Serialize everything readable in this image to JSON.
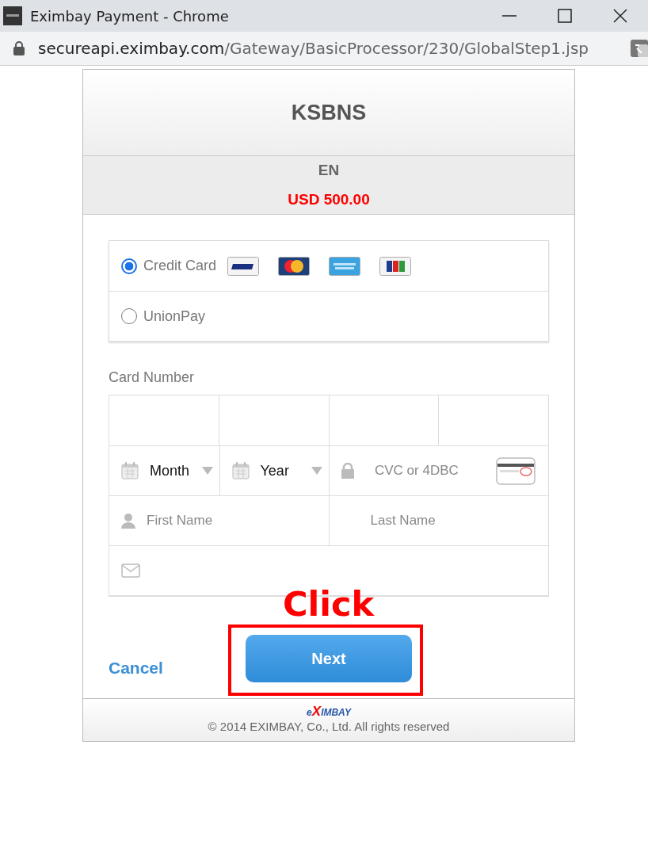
{
  "window": {
    "title": "Eximbay Payment - Chrome",
    "url_host": "secureapi.eximbay.com",
    "url_path": "/Gateway/BasicProcessor/230/GlobalStep1.jsp"
  },
  "merchant": {
    "name": "KSBNS",
    "language": "EN",
    "amount": "USD 500.00"
  },
  "payment_methods": [
    {
      "label": "Credit Card",
      "selected": true,
      "kind": "cards"
    },
    {
      "label": "UnionPay",
      "selected": false,
      "kind": "plain"
    }
  ],
  "card_number": {
    "label": "Card Number"
  },
  "expiry": [
    {
      "value": "Month"
    },
    {
      "value": "Year"
    }
  ],
  "cvc": {
    "placeholder": "CVC or 4DBC"
  },
  "name_fields": [
    {
      "placeholder": "First Name"
    },
    {
      "placeholder": "Last Name"
    }
  ],
  "annotation": {
    "text": "Click"
  },
  "buttons": {
    "cancel": "Cancel",
    "next": "Next"
  },
  "footer": {
    "logo": [
      "e",
      "X",
      "IMBAY"
    ],
    "copyright": "© 2014 EXIMBAY, Co., Ltd. All rights reserved"
  }
}
